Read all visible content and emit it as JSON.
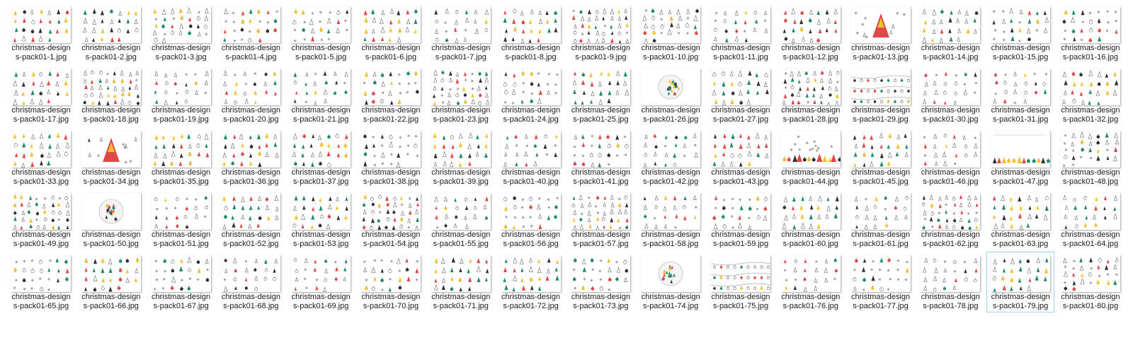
{
  "view": "large-icons",
  "selected_index": 79,
  "palette": [
    "#1f8a6b",
    "#e04848",
    "#f2c230",
    "#2f2f2f",
    "#9aa0a6",
    "#5aa4d8",
    "#c97a3a"
  ],
  "files": [
    {
      "line1": "christmas-design",
      "line2": "s-pack01-1.jpg",
      "style": "trees"
    },
    {
      "line1": "christmas-design",
      "line2": "s-pack01-2.jpg",
      "style": "trees"
    },
    {
      "line1": "christmas-design",
      "line2": "s-pack01-3.jpg",
      "style": "mixed"
    },
    {
      "line1": "christmas-design",
      "line2": "s-pack01-4.jpg",
      "style": "ornaments"
    },
    {
      "line1": "christmas-design",
      "line2": "s-pack01-5.jpg",
      "style": "ornaments"
    },
    {
      "line1": "christmas-design",
      "line2": "s-pack01-6.jpg",
      "style": "trees"
    },
    {
      "line1": "christmas-design",
      "line2": "s-pack01-7.jpg",
      "style": "sparse"
    },
    {
      "line1": "christmas-design",
      "line2": "s-pack01-8.jpg",
      "style": "trees"
    },
    {
      "line1": "christmas-design",
      "line2": "s-pack01-9.jpg",
      "style": "dense"
    },
    {
      "line1": "christmas-design",
      "line2": "s-pack01-10.jpg",
      "style": "mixed"
    },
    {
      "line1": "christmas-design",
      "line2": "s-pack01-11.jpg",
      "style": "sparse"
    },
    {
      "line1": "christmas-design",
      "line2": "s-pack01-12.jpg",
      "style": "trees"
    },
    {
      "line1": "christmas-design",
      "line2": "s-pack01-13.jpg",
      "style": "single-tree"
    },
    {
      "line1": "christmas-design",
      "line2": "s-pack01-14.jpg",
      "style": "trees"
    },
    {
      "line1": "christmas-design",
      "line2": "s-pack01-15.jpg",
      "style": "ornaments"
    },
    {
      "line1": "christmas-design",
      "line2": "s-pack01-16.jpg",
      "style": "ornaments"
    },
    {
      "line1": "christmas-design",
      "line2": "s-pack01-17.jpg",
      "style": "trees"
    },
    {
      "line1": "christmas-design",
      "line2": "s-pack01-18.jpg",
      "style": "dense"
    },
    {
      "line1": "christmas-design",
      "line2": "s-pack01-19.jpg",
      "style": "sparse"
    },
    {
      "line1": "christmas-design",
      "line2": "s-pack01-20.jpg",
      "style": "sparse"
    },
    {
      "line1": "christmas-design",
      "line2": "s-pack01-21.jpg",
      "style": "sparse"
    },
    {
      "line1": "christmas-design",
      "line2": "s-pack01-22.jpg",
      "style": "ornaments"
    },
    {
      "line1": "christmas-design",
      "line2": "s-pack01-23.jpg",
      "style": "dense"
    },
    {
      "line1": "christmas-design",
      "line2": "s-pack01-24.jpg",
      "style": "ornaments"
    },
    {
      "line1": "christmas-design",
      "line2": "s-pack01-25.jpg",
      "style": "trees"
    },
    {
      "line1": "christmas-design",
      "line2": "s-pack01-26.jpg",
      "style": "circle"
    },
    {
      "line1": "christmas-design",
      "line2": "s-pack01-27.jpg",
      "style": "trees"
    },
    {
      "line1": "christmas-design",
      "line2": "s-pack01-28.jpg",
      "style": "dense"
    },
    {
      "line1": "christmas-design",
      "line2": "s-pack01-29.jpg",
      "style": "garland"
    },
    {
      "line1": "christmas-design",
      "line2": "s-pack01-30.jpg",
      "style": "sparse"
    },
    {
      "line1": "christmas-design",
      "line2": "s-pack01-31.jpg",
      "style": "sparse"
    },
    {
      "line1": "christmas-design",
      "line2": "s-pack01-32.jpg",
      "style": "trees"
    },
    {
      "line1": "christmas-design",
      "line2": "s-pack01-33.jpg",
      "style": "trees"
    },
    {
      "line1": "christmas-design",
      "line2": "s-pack01-34.jpg",
      "style": "single-tree"
    },
    {
      "line1": "christmas-design",
      "line2": "s-pack01-35.jpg",
      "style": "trees"
    },
    {
      "line1": "christmas-design",
      "line2": "s-pack01-36.jpg",
      "style": "trees"
    },
    {
      "line1": "christmas-design",
      "line2": "s-pack01-37.jpg",
      "style": "trees"
    },
    {
      "line1": "christmas-design",
      "line2": "s-pack01-38.jpg",
      "style": "ornaments"
    },
    {
      "line1": "christmas-design",
      "line2": "s-pack01-39.jpg",
      "style": "trees"
    },
    {
      "line1": "christmas-design",
      "line2": "s-pack01-40.jpg",
      "style": "sparse"
    },
    {
      "line1": "christmas-design",
      "line2": "s-pack01-41.jpg",
      "style": "ornaments"
    },
    {
      "line1": "christmas-design",
      "line2": "s-pack01-42.jpg",
      "style": "sparse"
    },
    {
      "line1": "christmas-design",
      "line2": "s-pack01-43.jpg",
      "style": "trees"
    },
    {
      "line1": "christmas-design",
      "line2": "s-pack01-44.jpg",
      "style": "row-scene"
    },
    {
      "line1": "christmas-design",
      "line2": "s-pack01-45.jpg",
      "style": "trees"
    },
    {
      "line1": "christmas-design",
      "line2": "s-pack01-46.jpg",
      "style": "sparse"
    },
    {
      "line1": "christmas-design",
      "line2": "s-pack01-47.jpg",
      "style": "row-bottom"
    },
    {
      "line1": "christmas-design",
      "line2": "s-pack01-48.jpg",
      "style": "mixed"
    },
    {
      "line1": "christmas-design",
      "line2": "s-pack01-49.jpg",
      "style": "dense"
    },
    {
      "line1": "christmas-design",
      "line2": "s-pack01-50.jpg",
      "style": "circle"
    },
    {
      "line1": "christmas-design",
      "line2": "s-pack01-51.jpg",
      "style": "sparse"
    },
    {
      "line1": "christmas-design",
      "line2": "s-pack01-52.jpg",
      "style": "trees"
    },
    {
      "line1": "christmas-design",
      "line2": "s-pack01-53.jpg",
      "style": "trees"
    },
    {
      "line1": "christmas-design",
      "line2": "s-pack01-54.jpg",
      "style": "dense"
    },
    {
      "line1": "christmas-design",
      "line2": "s-pack01-55.jpg",
      "style": "sparse"
    },
    {
      "line1": "christmas-design",
      "line2": "s-pack01-56.jpg",
      "style": "ornaments"
    },
    {
      "line1": "christmas-design",
      "line2": "s-pack01-57.jpg",
      "style": "dense"
    },
    {
      "line1": "christmas-design",
      "line2": "s-pack01-58.jpg",
      "style": "sparse"
    },
    {
      "line1": "christmas-design",
      "line2": "s-pack01-59.jpg",
      "style": "ornaments"
    },
    {
      "line1": "christmas-design",
      "line2": "s-pack01-60.jpg",
      "style": "trees"
    },
    {
      "line1": "christmas-design",
      "line2": "s-pack01-61.jpg",
      "style": "sparse"
    },
    {
      "line1": "christmas-design",
      "line2": "s-pack01-62.jpg",
      "style": "dense"
    },
    {
      "line1": "christmas-design",
      "line2": "s-pack01-63.jpg",
      "style": "trees"
    },
    {
      "line1": "christmas-design",
      "line2": "s-pack01-64.jpg",
      "style": "sparse"
    },
    {
      "line1": "christmas-design",
      "line2": "s-pack01-65.jpg",
      "style": "ornaments"
    },
    {
      "line1": "christmas-design",
      "line2": "s-pack01-66.jpg",
      "style": "trees"
    },
    {
      "line1": "christmas-design",
      "line2": "s-pack01-67.jpg",
      "style": "ornaments"
    },
    {
      "line1": "christmas-design",
      "line2": "s-pack01-68.jpg",
      "style": "sparse"
    },
    {
      "line1": "christmas-design",
      "line2": "s-pack01-69.jpg",
      "style": "sparse"
    },
    {
      "line1": "christmas-design",
      "line2": "s-pack01-70.jpg",
      "style": "ornaments"
    },
    {
      "line1": "christmas-design",
      "line2": "s-pack01-71.jpg",
      "style": "trees"
    },
    {
      "line1": "christmas-design",
      "line2": "s-pack01-72.jpg",
      "style": "trees"
    },
    {
      "line1": "christmas-design",
      "line2": "s-pack01-73.jpg",
      "style": "ornaments"
    },
    {
      "line1": "christmas-design",
      "line2": "s-pack01-74.jpg",
      "style": "circle"
    },
    {
      "line1": "christmas-design",
      "line2": "s-pack01-75.jpg",
      "style": "garland"
    },
    {
      "line1": "christmas-design",
      "line2": "s-pack01-76.jpg",
      "style": "sparse"
    },
    {
      "line1": "christmas-design",
      "line2": "s-pack01-77.jpg",
      "style": "ornaments"
    },
    {
      "line1": "christmas-design",
      "line2": "s-pack01-78.jpg",
      "style": "sparse"
    },
    {
      "line1": "christmas-design",
      "line2": "s-pack01-79.jpg",
      "style": "trees"
    },
    {
      "line1": "christmas-design",
      "line2": "s-pack01-80.jpg",
      "style": "mixed"
    }
  ]
}
